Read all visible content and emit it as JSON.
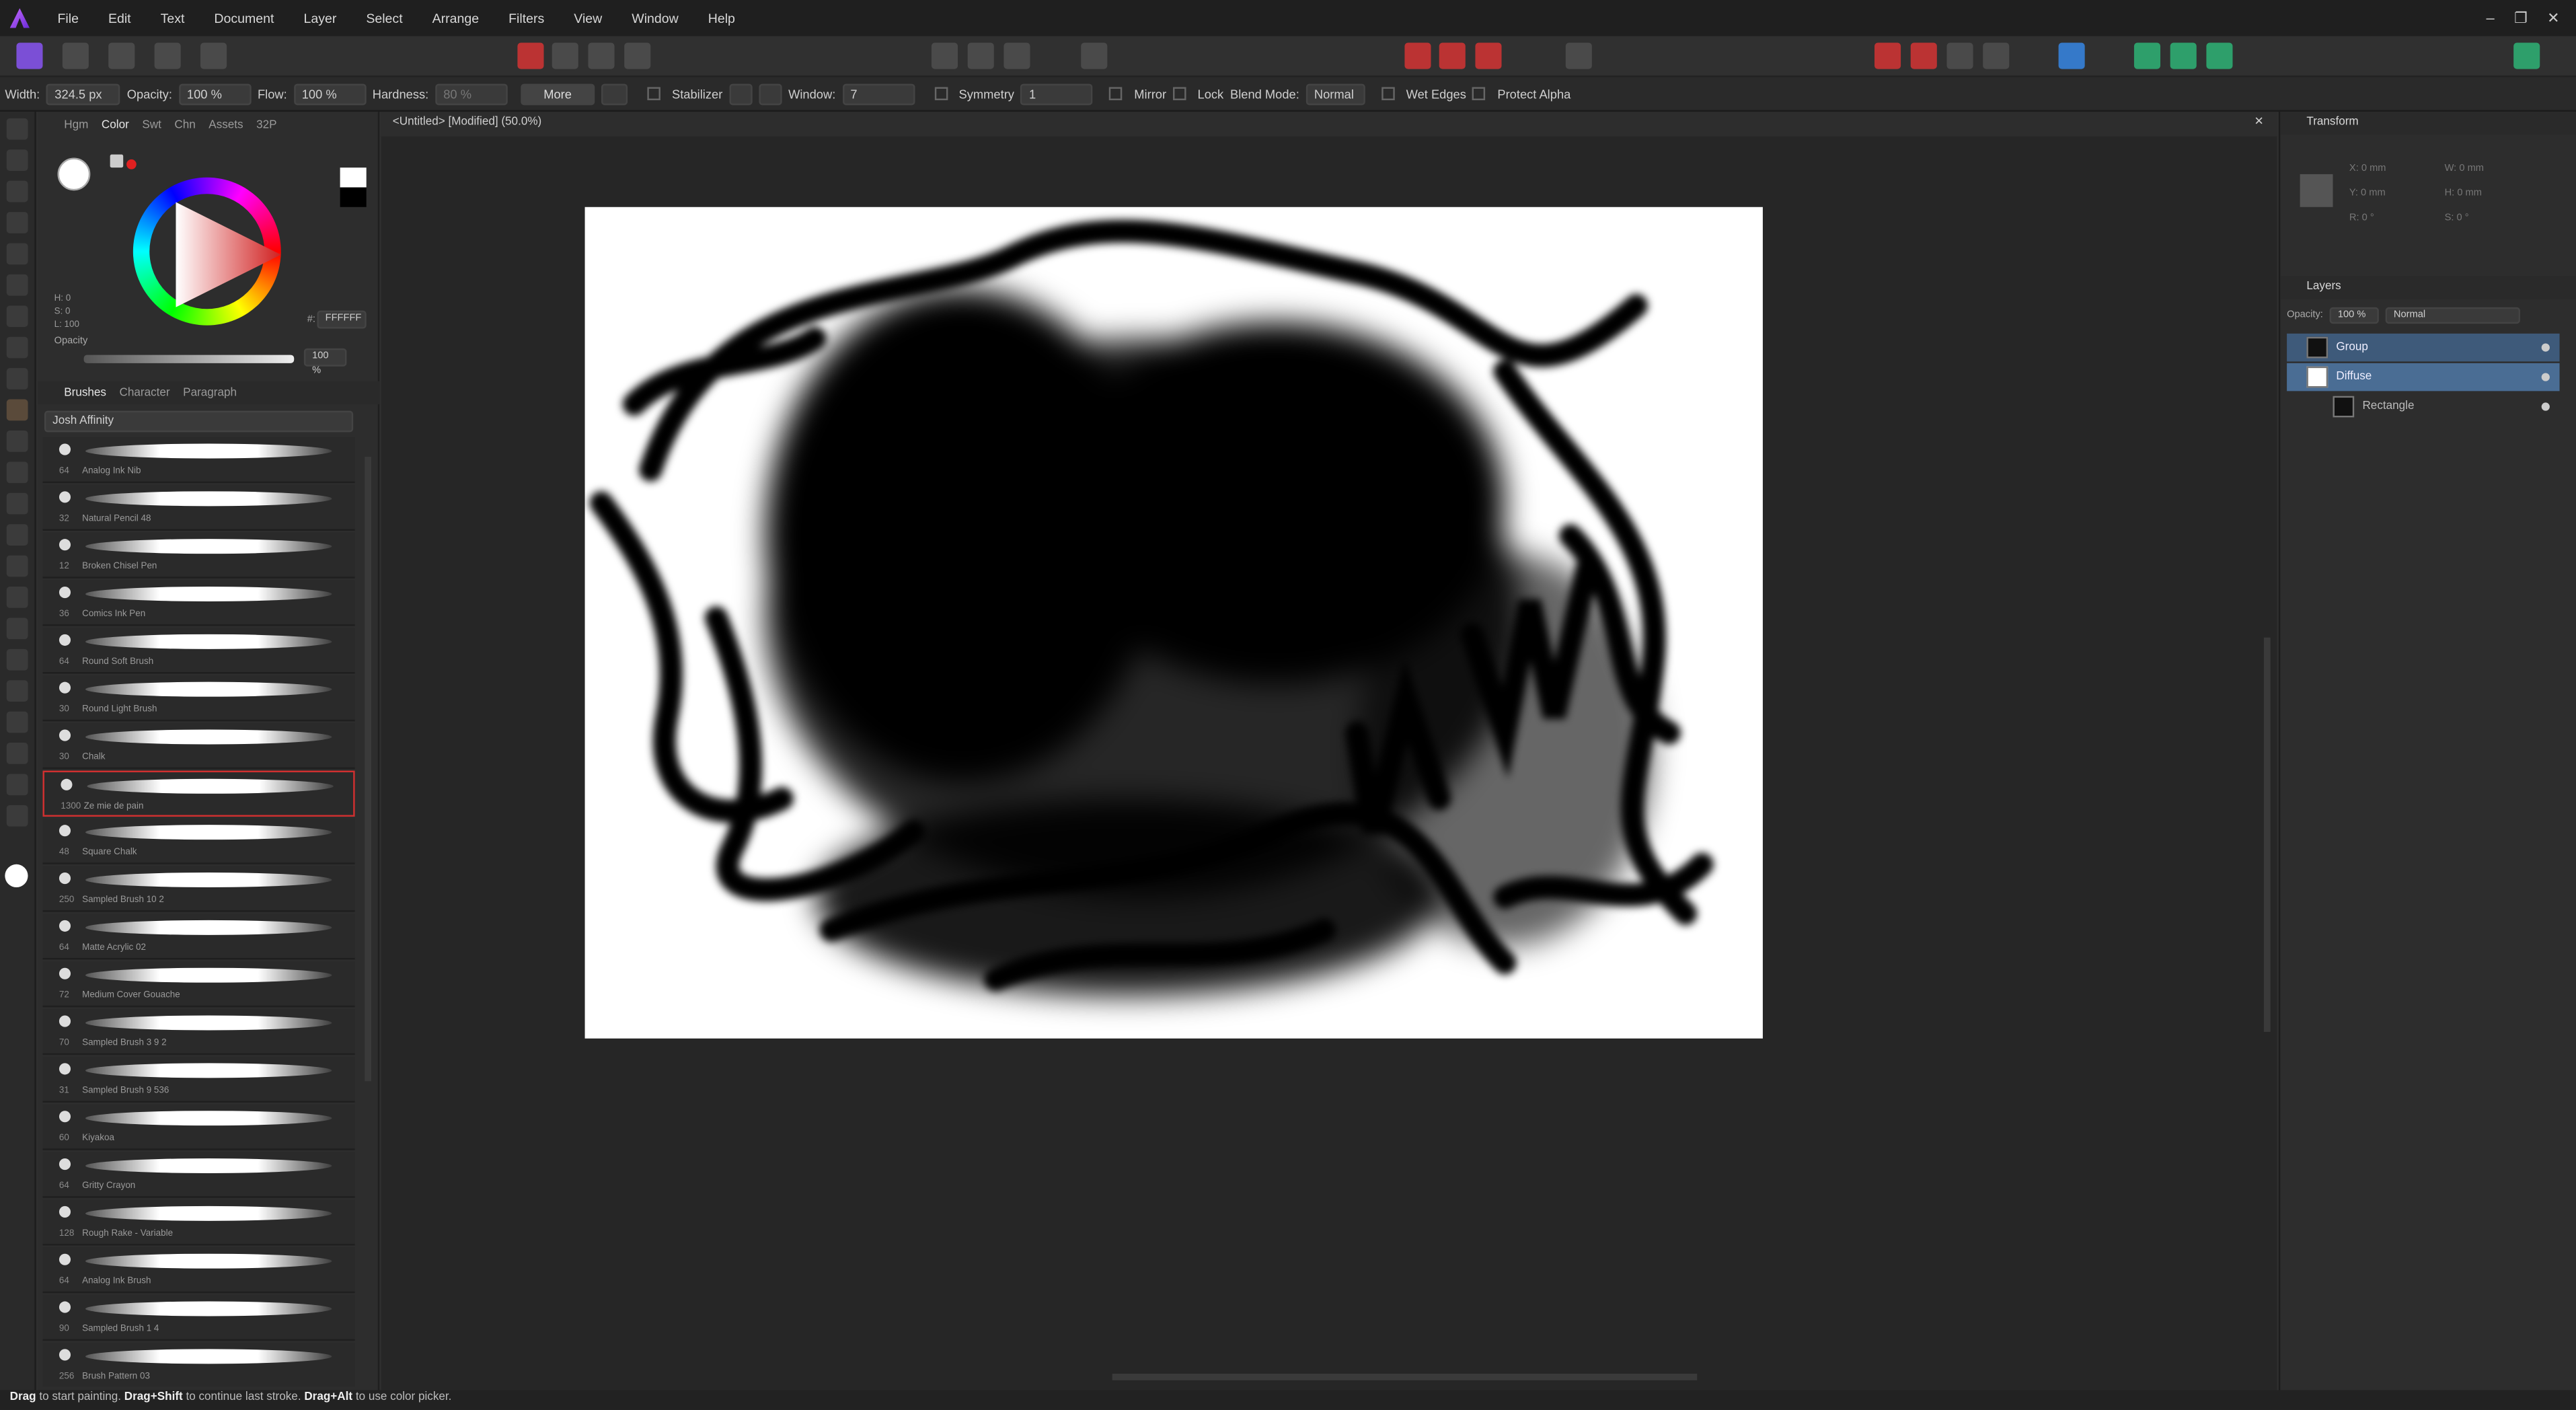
{
  "menu": {
    "items": [
      "File",
      "Edit",
      "Text",
      "Document",
      "Layer",
      "Select",
      "Arrange",
      "Filters",
      "View",
      "Window",
      "Help"
    ]
  },
  "window_controls": {
    "minimize": "–",
    "restore": "❐",
    "close": "✕"
  },
  "context": {
    "width_label": "Width:",
    "width_value": "324.5 px",
    "opacity_label": "Opacity:",
    "opacity_value": "100 %",
    "flow_label": "Flow:",
    "flow_value": "100 %",
    "hardness_label": "Hardness:",
    "hardness_value": "80 %",
    "more_label": "More",
    "stabilizer_label": "Stabilizer",
    "window_label": "Window:",
    "window_value": "7",
    "symmetry_label": "Symmetry",
    "symmetry_value": "1",
    "mirror_label": "Mirror",
    "lock_label": "Lock",
    "blend_label": "Blend Mode:",
    "blend_value": "Normal",
    "wet_edges_label": "Wet Edges",
    "protect_alpha_label": "Protect Alpha"
  },
  "color_panel": {
    "tabs": [
      "Hgm",
      "Color",
      "Swt",
      "Chn",
      "Assets",
      "32P"
    ],
    "active_tab": "Color",
    "h": "H: 0",
    "s": "S: 0",
    "l": "L: 100",
    "hex_label": "#:",
    "hex_value": "FFFFFF",
    "opacity_label": "Opacity",
    "opacity_value": "100 %"
  },
  "brushes_panel": {
    "tabs": [
      "Brushes",
      "Character",
      "Paragraph"
    ],
    "category": "Josh Affinity",
    "items": [
      {
        "size": "64",
        "name": "Analog Ink Nib"
      },
      {
        "size": "32",
        "name": "Natural Pencil 48"
      },
      {
        "size": "12",
        "name": "Broken Chisel Pen"
      },
      {
        "size": "36",
        "name": "Comics Ink Pen"
      },
      {
        "size": "64",
        "name": "Round Soft Brush"
      },
      {
        "size": "30",
        "name": "Round Light Brush"
      },
      {
        "size": "30",
        "name": "Chalk"
      },
      {
        "size": "1300",
        "name": "Ze mie de pain"
      },
      {
        "size": "48",
        "name": "Square Chalk"
      },
      {
        "size": "250",
        "name": "Sampled Brush 10 2"
      },
      {
        "size": "64",
        "name": "Matte Acrylic 02"
      },
      {
        "size": "72",
        "name": "Medium Cover Gouache"
      },
      {
        "size": "70",
        "name": "Sampled Brush 3 9 2"
      },
      {
        "size": "31",
        "name": "Sampled Brush 9 536"
      },
      {
        "size": "60",
        "name": "Kiyakoa"
      },
      {
        "size": "64",
        "name": "Gritty Crayon"
      },
      {
        "size": "128",
        "name": "Rough Rake - Variable"
      },
      {
        "size": "64",
        "name": "Analog Ink Brush"
      },
      {
        "size": "90",
        "name": "Sampled Brush 1 4"
      },
      {
        "size": "256",
        "name": "Brush Pattern 03"
      }
    ],
    "selected_index": 7
  },
  "document": {
    "tab_title": "<Untitled> [Modified] (50.0%)",
    "close": "✕"
  },
  "transform_panel": {
    "title": "Transform",
    "x": "X:",
    "x_value": "0 mm",
    "w": "W:",
    "w_value": "0 mm",
    "y": "Y:",
    "y_value": "0 mm",
    "h": "H:",
    "h_value": "0 mm",
    "r": "R:",
    "r_value": "0 °",
    "s": "S:",
    "s_value": "0 °"
  },
  "layers_panel": {
    "title": "Layers",
    "opacity_label": "Opacity:",
    "opacity_value": "100 %",
    "blend_value": "Normal",
    "layers": [
      {
        "name": "Group"
      },
      {
        "name": "Diffuse"
      },
      {
        "name": "Rectangle"
      }
    ]
  },
  "status": {
    "k1": "Drag",
    "t1": " to start painting. ",
    "k2": "Drag+Shift",
    "t2": " to continue last stroke. ",
    "k3": "Drag+Alt",
    "t3": " to use color picker."
  },
  "colors": {
    "accent": "#7b4fd6",
    "selection": "#3e5a7a",
    "selected_brush_border": "#d03030"
  }
}
